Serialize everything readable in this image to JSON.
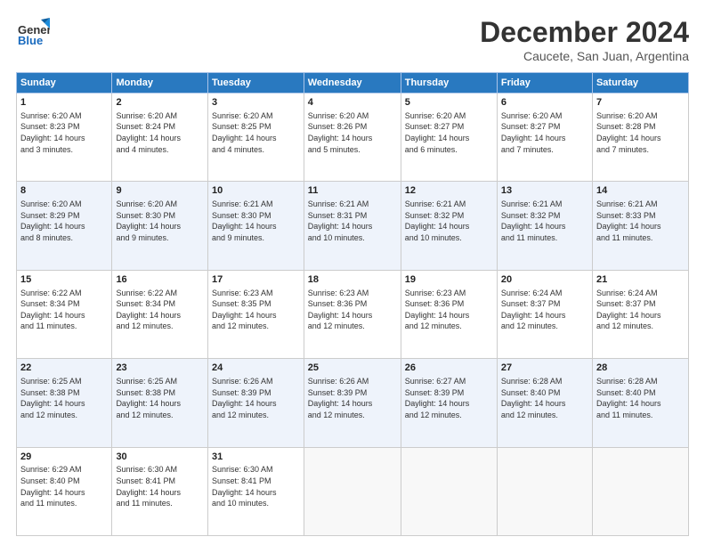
{
  "logo": {
    "line1": "General",
    "line2": "Blue",
    "bird_color": "#1a8cdc"
  },
  "title": "December 2024",
  "subtitle": "Caucete, San Juan, Argentina",
  "header_days": [
    "Sunday",
    "Monday",
    "Tuesday",
    "Wednesday",
    "Thursday",
    "Friday",
    "Saturday"
  ],
  "weeks": [
    [
      {
        "day": "1",
        "info": "Sunrise: 6:20 AM\nSunset: 8:23 PM\nDaylight: 14 hours\nand 3 minutes."
      },
      {
        "day": "2",
        "info": "Sunrise: 6:20 AM\nSunset: 8:24 PM\nDaylight: 14 hours\nand 4 minutes."
      },
      {
        "day": "3",
        "info": "Sunrise: 6:20 AM\nSunset: 8:25 PM\nDaylight: 14 hours\nand 4 minutes."
      },
      {
        "day": "4",
        "info": "Sunrise: 6:20 AM\nSunset: 8:26 PM\nDaylight: 14 hours\nand 5 minutes."
      },
      {
        "day": "5",
        "info": "Sunrise: 6:20 AM\nSunset: 8:27 PM\nDaylight: 14 hours\nand 6 minutes."
      },
      {
        "day": "6",
        "info": "Sunrise: 6:20 AM\nSunset: 8:27 PM\nDaylight: 14 hours\nand 7 minutes."
      },
      {
        "day": "7",
        "info": "Sunrise: 6:20 AM\nSunset: 8:28 PM\nDaylight: 14 hours\nand 7 minutes."
      }
    ],
    [
      {
        "day": "8",
        "info": "Sunrise: 6:20 AM\nSunset: 8:29 PM\nDaylight: 14 hours\nand 8 minutes."
      },
      {
        "day": "9",
        "info": "Sunrise: 6:20 AM\nSunset: 8:30 PM\nDaylight: 14 hours\nand 9 minutes."
      },
      {
        "day": "10",
        "info": "Sunrise: 6:21 AM\nSunset: 8:30 PM\nDaylight: 14 hours\nand 9 minutes."
      },
      {
        "day": "11",
        "info": "Sunrise: 6:21 AM\nSunset: 8:31 PM\nDaylight: 14 hours\nand 10 minutes."
      },
      {
        "day": "12",
        "info": "Sunrise: 6:21 AM\nSunset: 8:32 PM\nDaylight: 14 hours\nand 10 minutes."
      },
      {
        "day": "13",
        "info": "Sunrise: 6:21 AM\nSunset: 8:32 PM\nDaylight: 14 hours\nand 11 minutes."
      },
      {
        "day": "14",
        "info": "Sunrise: 6:21 AM\nSunset: 8:33 PM\nDaylight: 14 hours\nand 11 minutes."
      }
    ],
    [
      {
        "day": "15",
        "info": "Sunrise: 6:22 AM\nSunset: 8:34 PM\nDaylight: 14 hours\nand 11 minutes."
      },
      {
        "day": "16",
        "info": "Sunrise: 6:22 AM\nSunset: 8:34 PM\nDaylight: 14 hours\nand 12 minutes."
      },
      {
        "day": "17",
        "info": "Sunrise: 6:23 AM\nSunset: 8:35 PM\nDaylight: 14 hours\nand 12 minutes."
      },
      {
        "day": "18",
        "info": "Sunrise: 6:23 AM\nSunset: 8:36 PM\nDaylight: 14 hours\nand 12 minutes."
      },
      {
        "day": "19",
        "info": "Sunrise: 6:23 AM\nSunset: 8:36 PM\nDaylight: 14 hours\nand 12 minutes."
      },
      {
        "day": "20",
        "info": "Sunrise: 6:24 AM\nSunset: 8:37 PM\nDaylight: 14 hours\nand 12 minutes."
      },
      {
        "day": "21",
        "info": "Sunrise: 6:24 AM\nSunset: 8:37 PM\nDaylight: 14 hours\nand 12 minutes."
      }
    ],
    [
      {
        "day": "22",
        "info": "Sunrise: 6:25 AM\nSunset: 8:38 PM\nDaylight: 14 hours\nand 12 minutes."
      },
      {
        "day": "23",
        "info": "Sunrise: 6:25 AM\nSunset: 8:38 PM\nDaylight: 14 hours\nand 12 minutes."
      },
      {
        "day": "24",
        "info": "Sunrise: 6:26 AM\nSunset: 8:39 PM\nDaylight: 14 hours\nand 12 minutes."
      },
      {
        "day": "25",
        "info": "Sunrise: 6:26 AM\nSunset: 8:39 PM\nDaylight: 14 hours\nand 12 minutes."
      },
      {
        "day": "26",
        "info": "Sunrise: 6:27 AM\nSunset: 8:39 PM\nDaylight: 14 hours\nand 12 minutes."
      },
      {
        "day": "27",
        "info": "Sunrise: 6:28 AM\nSunset: 8:40 PM\nDaylight: 14 hours\nand 12 minutes."
      },
      {
        "day": "28",
        "info": "Sunrise: 6:28 AM\nSunset: 8:40 PM\nDaylight: 14 hours\nand 11 minutes."
      }
    ],
    [
      {
        "day": "29",
        "info": "Sunrise: 6:29 AM\nSunset: 8:40 PM\nDaylight: 14 hours\nand 11 minutes."
      },
      {
        "day": "30",
        "info": "Sunrise: 6:30 AM\nSunset: 8:41 PM\nDaylight: 14 hours\nand 11 minutes."
      },
      {
        "day": "31",
        "info": "Sunrise: 6:30 AM\nSunset: 8:41 PM\nDaylight: 14 hours\nand 10 minutes."
      },
      {
        "day": "",
        "info": ""
      },
      {
        "day": "",
        "info": ""
      },
      {
        "day": "",
        "info": ""
      },
      {
        "day": "",
        "info": ""
      }
    ]
  ]
}
